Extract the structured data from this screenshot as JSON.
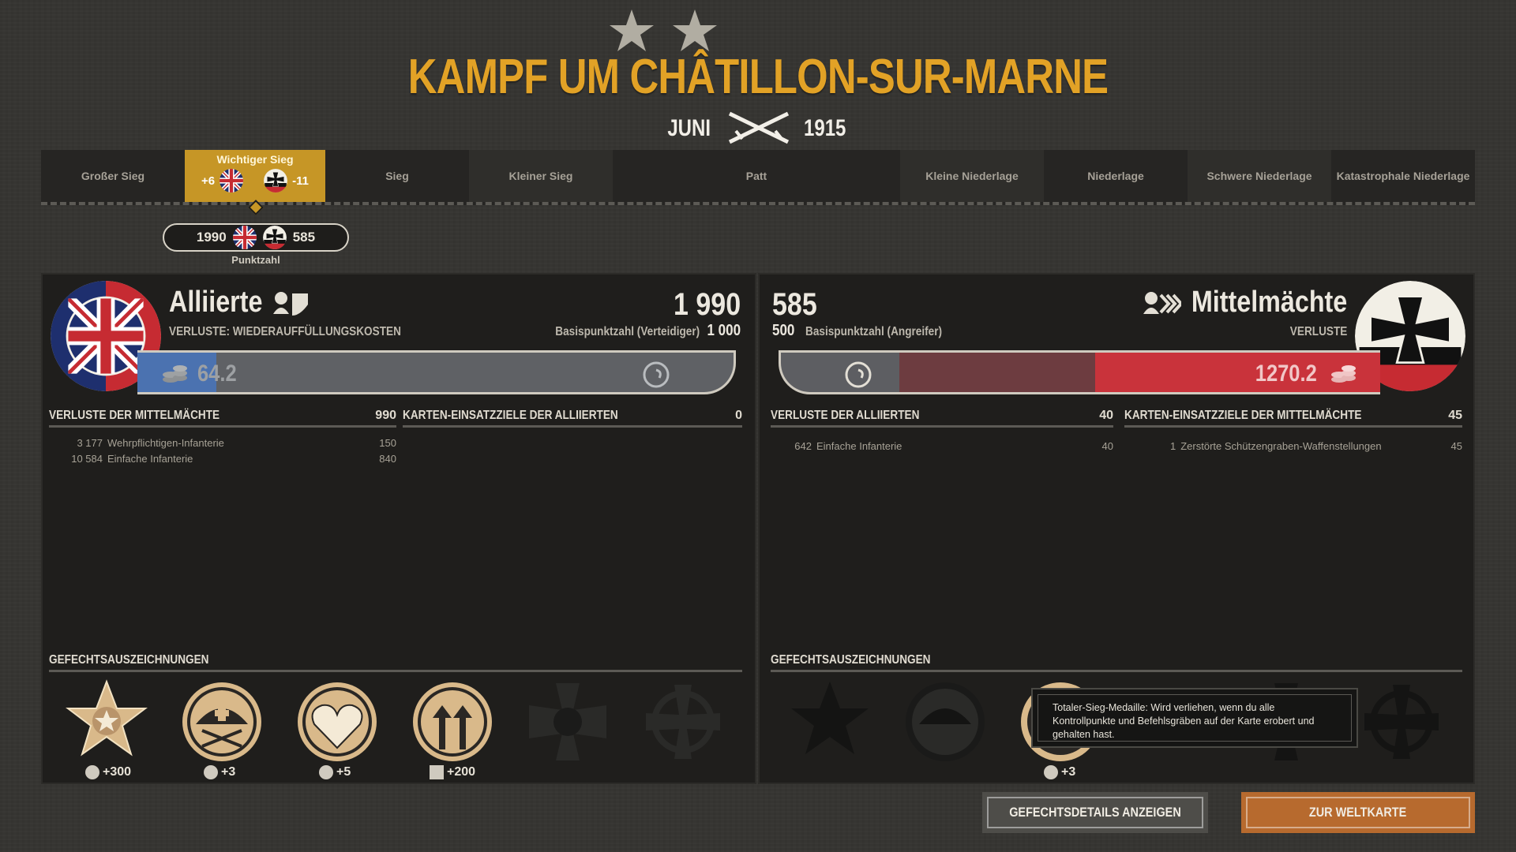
{
  "header": {
    "title": "KAMPF UM CHÂTILLON-SUR-MARNE",
    "month": "JUNI",
    "year": "1915",
    "stars": 2
  },
  "outcomes": [
    {
      "label": "Großer Sieg"
    },
    {
      "label": "Wichtiger Sieg",
      "active": true,
      "allies_delta": "+6",
      "central_delta": "-11"
    },
    {
      "label": "Sieg"
    },
    {
      "label": "Kleiner Sieg"
    },
    {
      "label": "Patt"
    },
    {
      "label": "Kleine Niederlage"
    },
    {
      "label": "Niederlage"
    },
    {
      "label": "Schwere Niederlage"
    },
    {
      "label": "Katastrophale Niederlage"
    }
  ],
  "score": {
    "allies": "1990",
    "central": "585",
    "caption": "Punktzahl"
  },
  "allies": {
    "name": "Alliierte",
    "score": "1 990",
    "losses_label": "VERLUSTE: WIEDERAUFFÜLLUNGSKOSTEN",
    "base_label": "Basispunktzahl (Verteidiger)",
    "base_value": "1 000",
    "bar_value": "64.2",
    "losses_section": {
      "title": "VERLUSTE DER MITTELMÄCHTE",
      "total": "990",
      "rows": [
        {
          "count": "3 177",
          "name": "Wehrpflichtigen-Infanterie",
          "value": "150"
        },
        {
          "count": "10 584",
          "name": "Einfache Infanterie",
          "value": "840"
        }
      ]
    },
    "objectives_section": {
      "title": "KARTEN-EINSATZZIELE DER ALLIIERTEN",
      "total": "0"
    },
    "awards_title": "GEFECHTSAUSZEICHNUNGEN",
    "medals": [
      {
        "icon": "star-medal-icon",
        "value": "+300",
        "earned": true
      },
      {
        "icon": "helmet-medal-icon",
        "value": "+3",
        "earned": true
      },
      {
        "icon": "heart-medal-icon",
        "value": "+5",
        "earned": true
      },
      {
        "icon": "arrows-medal-icon",
        "value": "+200",
        "earned": true
      },
      {
        "icon": "iron-cross-medal-icon",
        "value": "",
        "earned": false
      },
      {
        "icon": "round-cross-medal-icon",
        "value": "",
        "earned": false
      }
    ]
  },
  "central": {
    "name": "Mittelmächte",
    "score": "585",
    "base_value": "500",
    "base_label": "Basispunktzahl (Angreifer)",
    "losses_label": "VERLUSTE",
    "bar_value": "1270.2",
    "losses_section": {
      "title": "VERLUSTE DER ALLIIERTEN",
      "total": "40",
      "rows": [
        {
          "count": "642",
          "name": "Einfache Infanterie",
          "value": "40"
        }
      ]
    },
    "objectives_section": {
      "title": "KARTEN-EINSATZZIELE DER MITTELMÄCHTE",
      "total": "45",
      "rows": [
        {
          "count": "1",
          "name": "Zerstörte Schützengraben-Waffenstellungen",
          "value": "45"
        }
      ]
    },
    "awards_title": "GEFECHTSAUSZEICHNUNGEN",
    "medals": [
      {
        "icon": "star-medal-icon",
        "value": "",
        "earned": false
      },
      {
        "icon": "helmet-medal-icon",
        "value": "",
        "earned": false
      },
      {
        "icon": "total-victory-medal-icon",
        "value": "+3",
        "earned": true
      },
      {
        "icon": "iron-cross-medal-icon",
        "value": "",
        "earned": false
      },
      {
        "icon": "round-cross-medal-icon",
        "value": "",
        "earned": false
      }
    ]
  },
  "tooltip": {
    "text": "Totaler-Sieg-Medaille: Wird verliehen, wenn du alle Kontrollpunkte und Befehlsgräben auf der Karte erobert und gehalten hast."
  },
  "buttons": {
    "details": "GEFECHTSDETAILS ANZEIGEN",
    "world_map": "ZUR WELTKARTE"
  },
  "colors": {
    "title": "#e2a226",
    "active_outcome": "#c69626",
    "allies_blue": "#4b72b0",
    "central_red": "#c9333b",
    "world_map_button": "#b76a2e"
  }
}
